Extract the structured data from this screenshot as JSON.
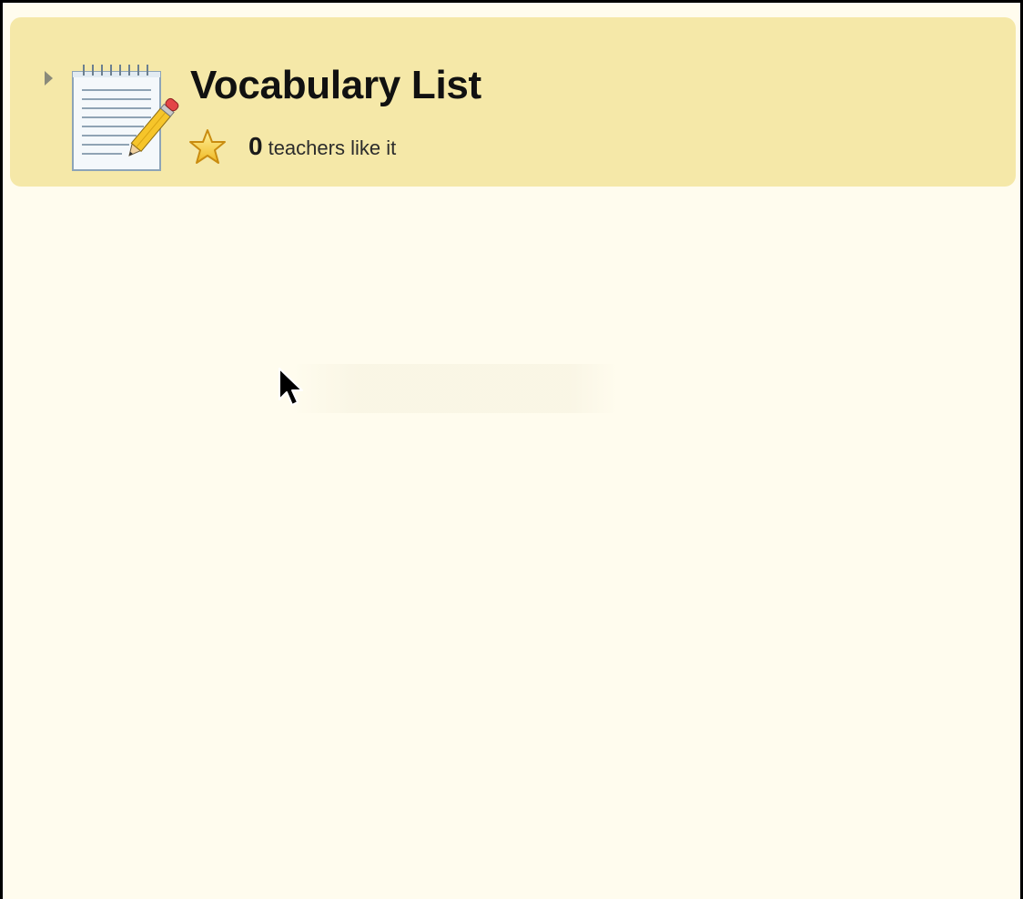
{
  "card": {
    "title": "Vocabulary List",
    "like_count": "0",
    "like_suffix": "teachers like it"
  },
  "icons": {
    "expand": "expand-arrow-icon",
    "notepad": "notepad-with-pencil-icon",
    "star": "star-icon",
    "cursor": "mouse-pointer-icon"
  },
  "colors": {
    "page_background": "#fffcee",
    "card_background": "#f5e8a8",
    "frame": "#000000",
    "title_text": "#111111"
  }
}
